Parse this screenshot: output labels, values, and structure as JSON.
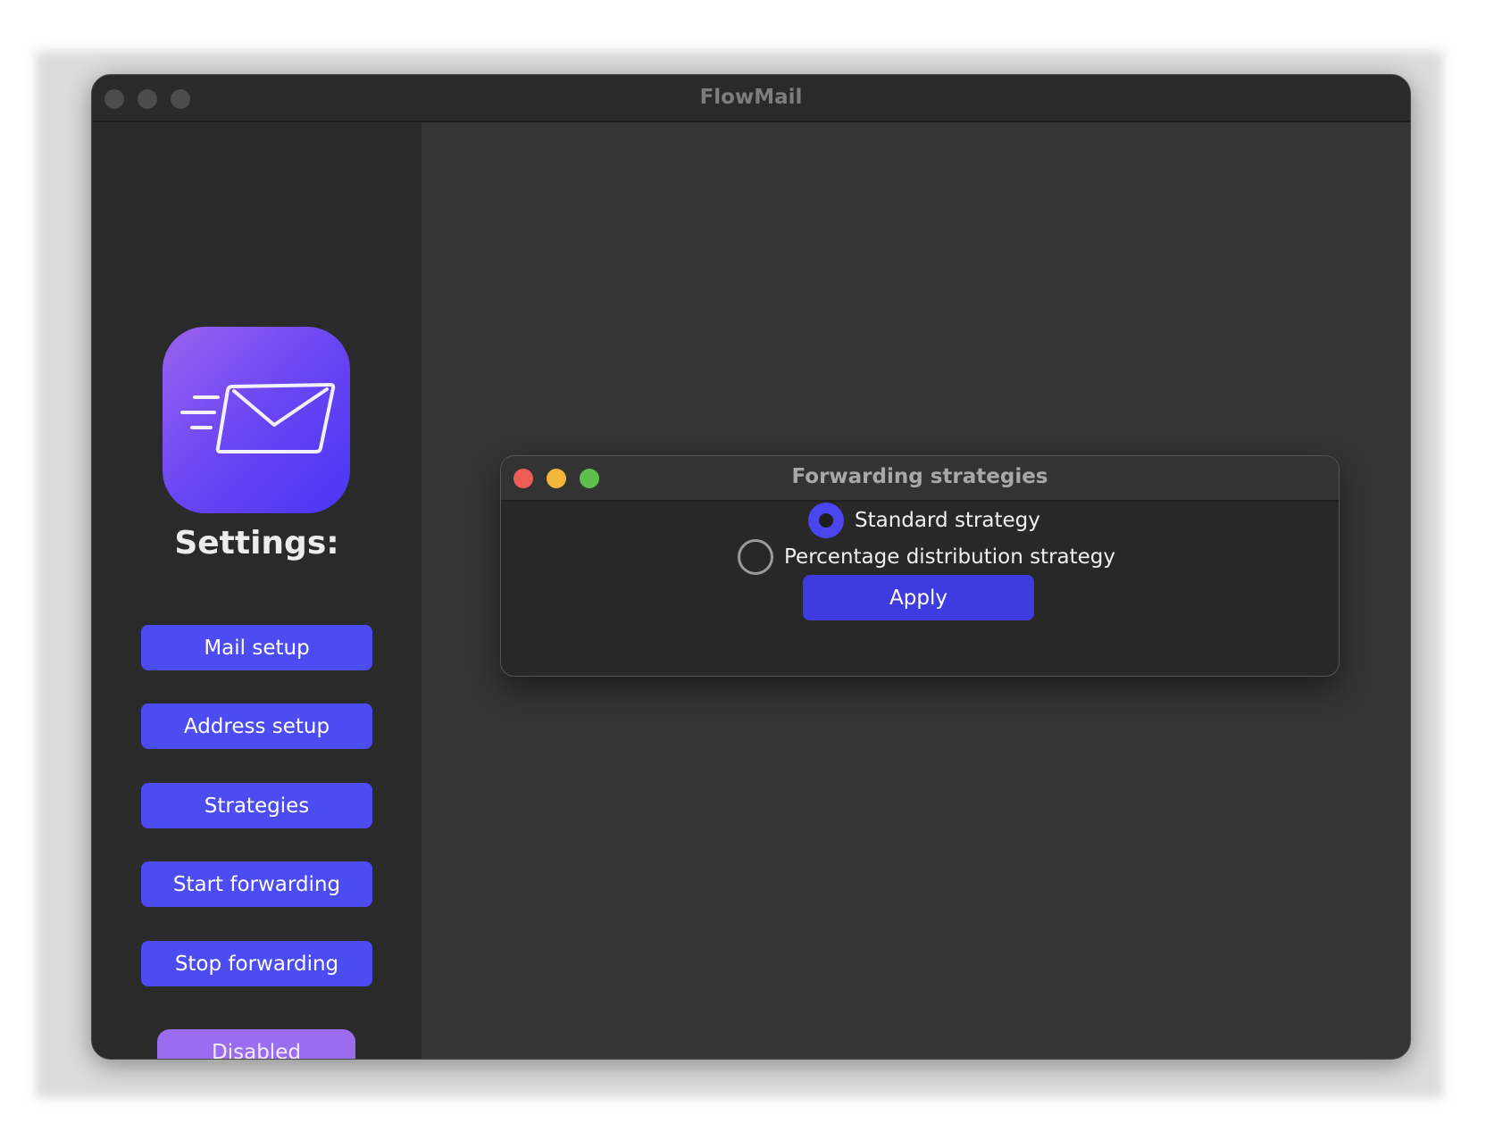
{
  "window": {
    "title": "FlowMail"
  },
  "sidebar": {
    "app_icon": "mail-send-icon",
    "heading": "Settings:",
    "buttons": [
      {
        "label": "Mail setup"
      },
      {
        "label": "Address setup"
      },
      {
        "label": "Strategies"
      },
      {
        "label": "Start forwarding"
      },
      {
        "label": "Stop forwarding"
      }
    ],
    "status_button": "Disabled"
  },
  "dialog": {
    "title": "Forwarding strategies",
    "options": [
      {
        "label": "Standard strategy",
        "selected": true
      },
      {
        "label": "Percentage distribution strategy",
        "selected": false
      }
    ],
    "apply_label": "Apply"
  },
  "colors": {
    "accent": "#4d4cf2",
    "status_purple": "#9b6cef",
    "traffic_red": "#ec5f57",
    "traffic_yellow": "#f2b73a",
    "traffic_green": "#5ec04c"
  }
}
